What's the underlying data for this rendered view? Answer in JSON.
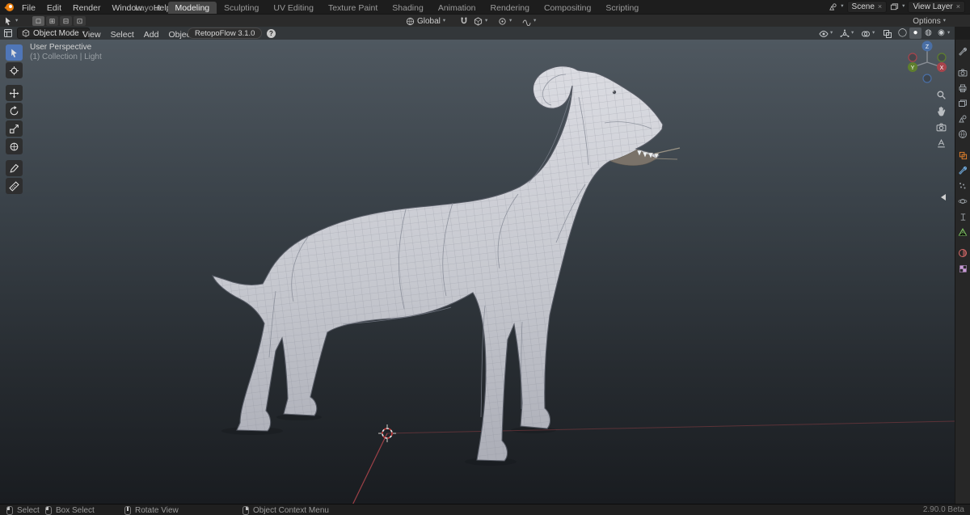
{
  "icons": {
    "chevron": "▾",
    "close": "×",
    "help": "?",
    "select_modes": [
      "□",
      "⊞",
      "⊟",
      "⊡"
    ],
    "shading_modes": [
      "◯",
      "●",
      "◍",
      "◉"
    ]
  },
  "topbar": {
    "menus": [
      "File",
      "Edit",
      "Render",
      "Window",
      "Help"
    ],
    "workspaces": [
      "Layout",
      "Modeling",
      "Sculpting",
      "UV Editing",
      "Texture Paint",
      "Shading",
      "Animation",
      "Rendering",
      "Compositing",
      "Scripting"
    ],
    "active_workspace": "Modeling",
    "scene": "Scene",
    "view_layer": "View Layer"
  },
  "tool_settings": {
    "orientation": "Global",
    "options": "Options"
  },
  "viewport_header": {
    "mode": "Object Mode",
    "menus": [
      "View",
      "Select",
      "Add",
      "Object"
    ],
    "retopoflow": "RetopoFlow 3.1.0"
  },
  "viewport": {
    "perspective": "User Perspective",
    "collection": "(1) Collection | Light"
  },
  "left_toolbar": {
    "tools": [
      "tweak-select",
      "cursor",
      "move",
      "rotate",
      "scale",
      "transform",
      "annotate",
      "measure"
    ]
  },
  "properties_tabs": [
    "tool",
    "render",
    "output",
    "view-layer",
    "scene",
    "world",
    "object",
    "modifiers",
    "particles",
    "physics",
    "constraints",
    "object-data",
    "material",
    "texture"
  ],
  "statusbar": {
    "hints": [
      "Select",
      "Box Select",
      "Rotate View",
      "Object Context Menu"
    ],
    "version": "2.90.0 Beta"
  },
  "colors": {
    "accent_blue": "#4f76b8",
    "object_orange": "#e8842c",
    "axis_x": "#b3474e",
    "axis_y": "#6fa21c",
    "axis_z": "#4a6fa5"
  }
}
